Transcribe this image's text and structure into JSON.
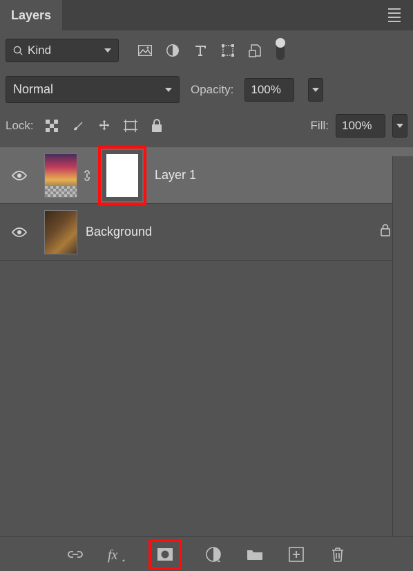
{
  "panel": {
    "title": "Layers"
  },
  "filter": {
    "kind_label": "Kind"
  },
  "blend": {
    "mode": "Normal",
    "opacity_label": "Opacity:",
    "opacity_value": "100%"
  },
  "lock": {
    "label": "Lock:",
    "fill_label": "Fill:",
    "fill_value": "100%"
  },
  "layers": [
    {
      "name": "Layer 1",
      "selected": true,
      "has_mask": true,
      "locked": false
    },
    {
      "name": "Background",
      "selected": false,
      "has_mask": false,
      "locked": true
    }
  ]
}
